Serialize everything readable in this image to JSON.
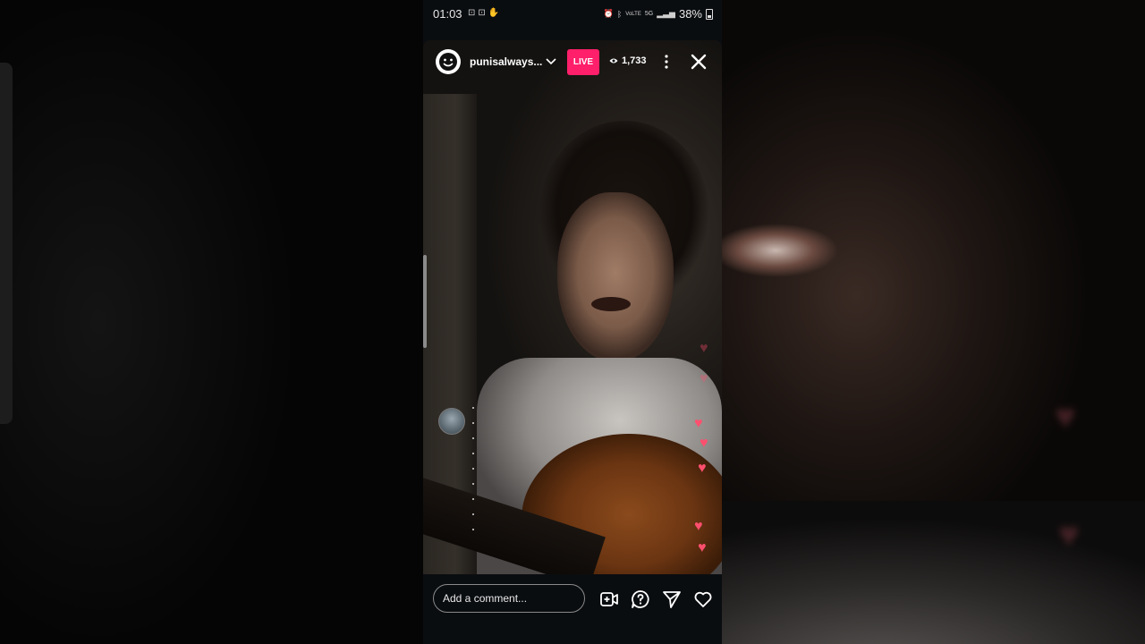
{
  "status_bar": {
    "time": "01:03",
    "notification_icons": [
      "screenshot-icon",
      "screenshot-icon",
      "hand-icon"
    ],
    "system_indicators": [
      "alarm-icon",
      "bluetooth-icon",
      "volte-icon",
      "5g-icon",
      "signal-icon"
    ],
    "network_label_1": "VoLTE",
    "network_label_2": "5G",
    "battery": "38%"
  },
  "live_header": {
    "username": "punisalways...",
    "live_badge": "LIVE",
    "viewer_count": "1,733",
    "accent_color": "#ff1f6a"
  },
  "reactions": {
    "heart_color": "#ff4f6e",
    "heart_count": 8
  },
  "bottom_bar": {
    "comment_placeholder": "Add a comment...",
    "icons": [
      "add-video-icon",
      "question-icon",
      "send-icon",
      "heart-icon"
    ]
  }
}
